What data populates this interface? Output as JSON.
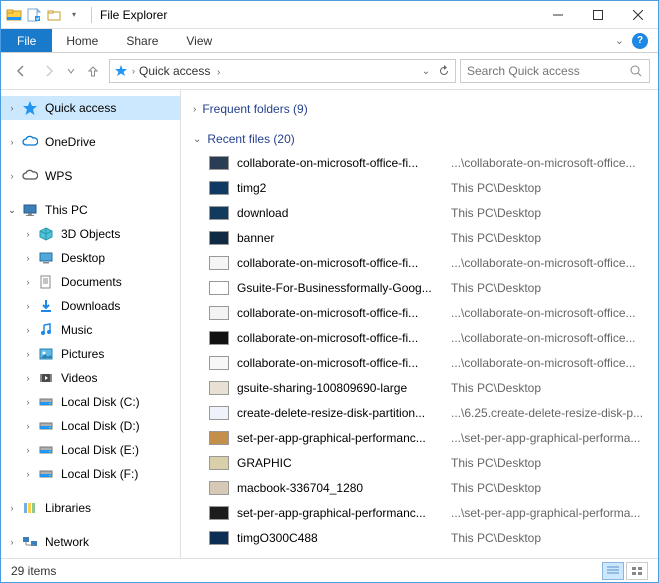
{
  "title": "File Explorer",
  "ribbon": {
    "file": "File",
    "tabs": [
      "Home",
      "Share",
      "View"
    ]
  },
  "address": {
    "text": "Quick access",
    "crumb_suffix": "›"
  },
  "search": {
    "placeholder": "Search Quick access"
  },
  "sidebar": {
    "quick_access": "Quick access",
    "onedrive": "OneDrive",
    "wps": "WPS",
    "this_pc": "This PC",
    "children": [
      {
        "label": "3D Objects",
        "icon": "cube"
      },
      {
        "label": "Desktop",
        "icon": "desktop"
      },
      {
        "label": "Documents",
        "icon": "doc"
      },
      {
        "label": "Downloads",
        "icon": "download"
      },
      {
        "label": "Music",
        "icon": "music"
      },
      {
        "label": "Pictures",
        "icon": "pictures"
      },
      {
        "label": "Videos",
        "icon": "videos"
      },
      {
        "label": "Local Disk (C:)",
        "icon": "disk"
      },
      {
        "label": "Local Disk (D:)",
        "icon": "disk"
      },
      {
        "label": "Local Disk  (E:)",
        "icon": "disk"
      },
      {
        "label": "Local Disk (F:)",
        "icon": "disk"
      }
    ],
    "libraries": "Libraries",
    "network": "Network"
  },
  "groups": {
    "frequent": {
      "label": "Frequent folders (9)"
    },
    "recent": {
      "label": "Recent files (20)"
    }
  },
  "files": [
    {
      "name": "collaborate-on-microsoft-office-fi...",
      "path": "...\\collaborate-on-microsoft-office...",
      "thumb": "#2b3c55"
    },
    {
      "name": "timg2",
      "path": "This PC\\Desktop",
      "thumb": "#0e3a63"
    },
    {
      "name": "download",
      "path": "This PC\\Desktop",
      "thumb": "#123a5e"
    },
    {
      "name": "banner",
      "path": "This PC\\Desktop",
      "thumb": "#102a44"
    },
    {
      "name": "collaborate-on-microsoft-office-fi...",
      "path": "...\\collaborate-on-microsoft-office...",
      "thumb": "#f5f5f5"
    },
    {
      "name": "Gsuite-For-Businessformally-Goog...",
      "path": "This PC\\Desktop",
      "thumb": "#ffffff"
    },
    {
      "name": "collaborate-on-microsoft-office-fi...",
      "path": "...\\collaborate-on-microsoft-office...",
      "thumb": "#f3f3f3"
    },
    {
      "name": "collaborate-on-microsoft-office-fi...",
      "path": "...\\collaborate-on-microsoft-office...",
      "thumb": "#111111"
    },
    {
      "name": "collaborate-on-microsoft-office-fi...",
      "path": "...\\collaborate-on-microsoft-office...",
      "thumb": "#f7f7f7"
    },
    {
      "name": "gsuite-sharing-100809690-large",
      "path": "This PC\\Desktop",
      "thumb": "#e9e0d4"
    },
    {
      "name": "create-delete-resize-disk-partition...",
      "path": "...\\6.25.create-delete-resize-disk-p...",
      "thumb": "#eef2fa"
    },
    {
      "name": "set-per-app-graphical-performanc...",
      "path": "...\\set-per-app-graphical-performa...",
      "thumb": "#c38f4a"
    },
    {
      "name": "GRAPHIC",
      "path": "This PC\\Desktop",
      "thumb": "#d9cfa8"
    },
    {
      "name": "macbook-336704_1280",
      "path": "This PC\\Desktop",
      "thumb": "#d6c9b5"
    },
    {
      "name": "set-per-app-graphical-performanc...",
      "path": "...\\set-per-app-graphical-performa...",
      "thumb": "#1c1c1c"
    },
    {
      "name": "timgO300C488",
      "path": "This PC\\Desktop",
      "thumb": "#0c2e55"
    }
  ],
  "status": {
    "count": "29 items"
  }
}
